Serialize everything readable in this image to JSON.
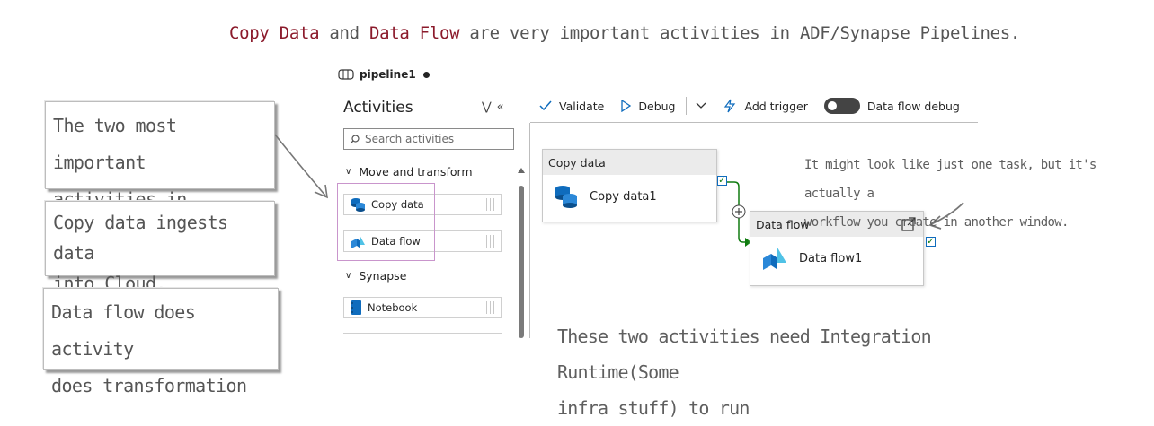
{
  "headline": {
    "part1": "Copy Data",
    "part2": " and ",
    "part3": "Data Flow",
    "part4": " are very important activities in ADF/Synapse Pipelines."
  },
  "notes": {
    "important_line1": "The two most important",
    "important_line2": "activities in Pipelines",
    "copy_line1": "Copy data ingests data",
    "copy_line2": "into Cloud.",
    "dataflow_line1": "Data flow does activity",
    "dataflow_line2": "does transformation"
  },
  "pipeline": {
    "title": "pipeline1"
  },
  "activities": {
    "title": "Activities",
    "search_placeholder": "Search activities",
    "groups": [
      {
        "label": "Move and transform",
        "items": [
          "Copy data",
          "Data flow"
        ]
      },
      {
        "label": "Synapse",
        "items": [
          "Notebook"
        ]
      }
    ]
  },
  "toolbar": {
    "validate": "Validate",
    "debug": "Debug",
    "add_trigger": "Add trigger",
    "dataflow_debug": "Data flow debug"
  },
  "canvas": {
    "copy_card": {
      "header": "Copy data",
      "name": "Copy data1"
    },
    "flow_card": {
      "header": "Data flow",
      "name": "Data flow1"
    }
  },
  "annotations": {
    "task_line1": "It might look like just one task, but it's actually a",
    "task_line2": "workflow you create in another window.",
    "ir_line1": "These two activities need Integration Runtime(Some",
    "ir_line2": "infra stuff) to run"
  },
  "colors": {
    "emphasis": "#8b1a2b",
    "accent": "#0f6cbd",
    "success": "#107c10",
    "highlight": "#c995cc"
  }
}
